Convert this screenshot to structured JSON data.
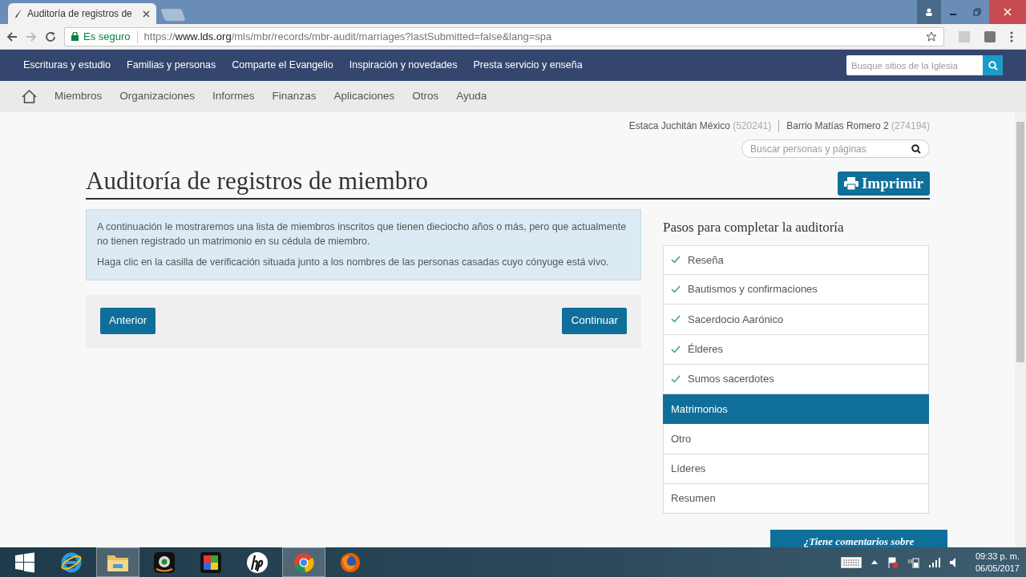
{
  "browser": {
    "tab_title": "Auditoría de registros de",
    "security": "Es seguro",
    "url_scheme": "https://",
    "url_host": "www.lds.org",
    "url_path": "/mls/mbr/records/mbr-audit/marriages?lastSubmitted=false&lang=spa"
  },
  "top_nav": {
    "items": [
      "Escrituras y estudio",
      "Familias y personas",
      "Comparte el Evangelio",
      "Inspiración y novedades",
      "Presta servicio y enseña"
    ],
    "search_placeholder": "Busque sitios de la Iglesia"
  },
  "sub_nav": {
    "items": [
      "Miembros",
      "Organizaciones",
      "Informes",
      "Finanzas",
      "Aplicaciones",
      "Otros",
      "Ayuda"
    ]
  },
  "unit": {
    "stake": "Estaca Juchitán México",
    "stake_number": "(520241)",
    "ward": "Barrio Matías Romero 2",
    "ward_number": "(274194)",
    "search_placeholder": "Buscar personas y páginas"
  },
  "page": {
    "title": "Auditoría de registros de miembro",
    "print_button": "Imprimir",
    "info": [
      "A continuación le mostraremos una lista de miembros inscritos que tienen dieciocho años o más, pero que actualmente no tienen registrado un matrimonio en su cédula de miembro.",
      "Haga clic en la casilla de verificación situada junto a los nombres de las personas casadas cuyo cónyuge está vivo."
    ],
    "buttons": [
      "Anterior",
      "Continuar"
    ]
  },
  "steps": {
    "title": "Pasos para completar la auditoría",
    "items": [
      {
        "label": "Reseña",
        "done": true,
        "selected": false
      },
      {
        "label": "Bautismos y confirmaciones",
        "done": true,
        "selected": false
      },
      {
        "label": "Sacerdocio Aarónico",
        "done": true,
        "selected": false
      },
      {
        "label": "Élderes",
        "done": true,
        "selected": false
      },
      {
        "label": "Sumos sacerdotes",
        "done": true,
        "selected": false
      },
      {
        "label": "Matrimonios",
        "done": false,
        "selected": true
      },
      {
        "label": "Otro",
        "done": false,
        "selected": false
      },
      {
        "label": "Líderes",
        "done": false,
        "selected": false
      },
      {
        "label": "Resumen",
        "done": false,
        "selected": false
      }
    ]
  },
  "feedback": "¿Tiene comentarios sobre",
  "taskbar": {
    "apps": [
      {
        "kind": "ie",
        "selected": false
      },
      {
        "kind": "folder",
        "selected": true
      },
      {
        "kind": "camera",
        "selected": false
      },
      {
        "kind": "puzzle",
        "selected": false
      },
      {
        "kind": "hp",
        "selected": false
      },
      {
        "kind": "chrome",
        "selected": true
      },
      {
        "kind": "firefox",
        "selected": false
      }
    ],
    "time": "09:33 p. m.",
    "date": "06/05/2017"
  }
}
